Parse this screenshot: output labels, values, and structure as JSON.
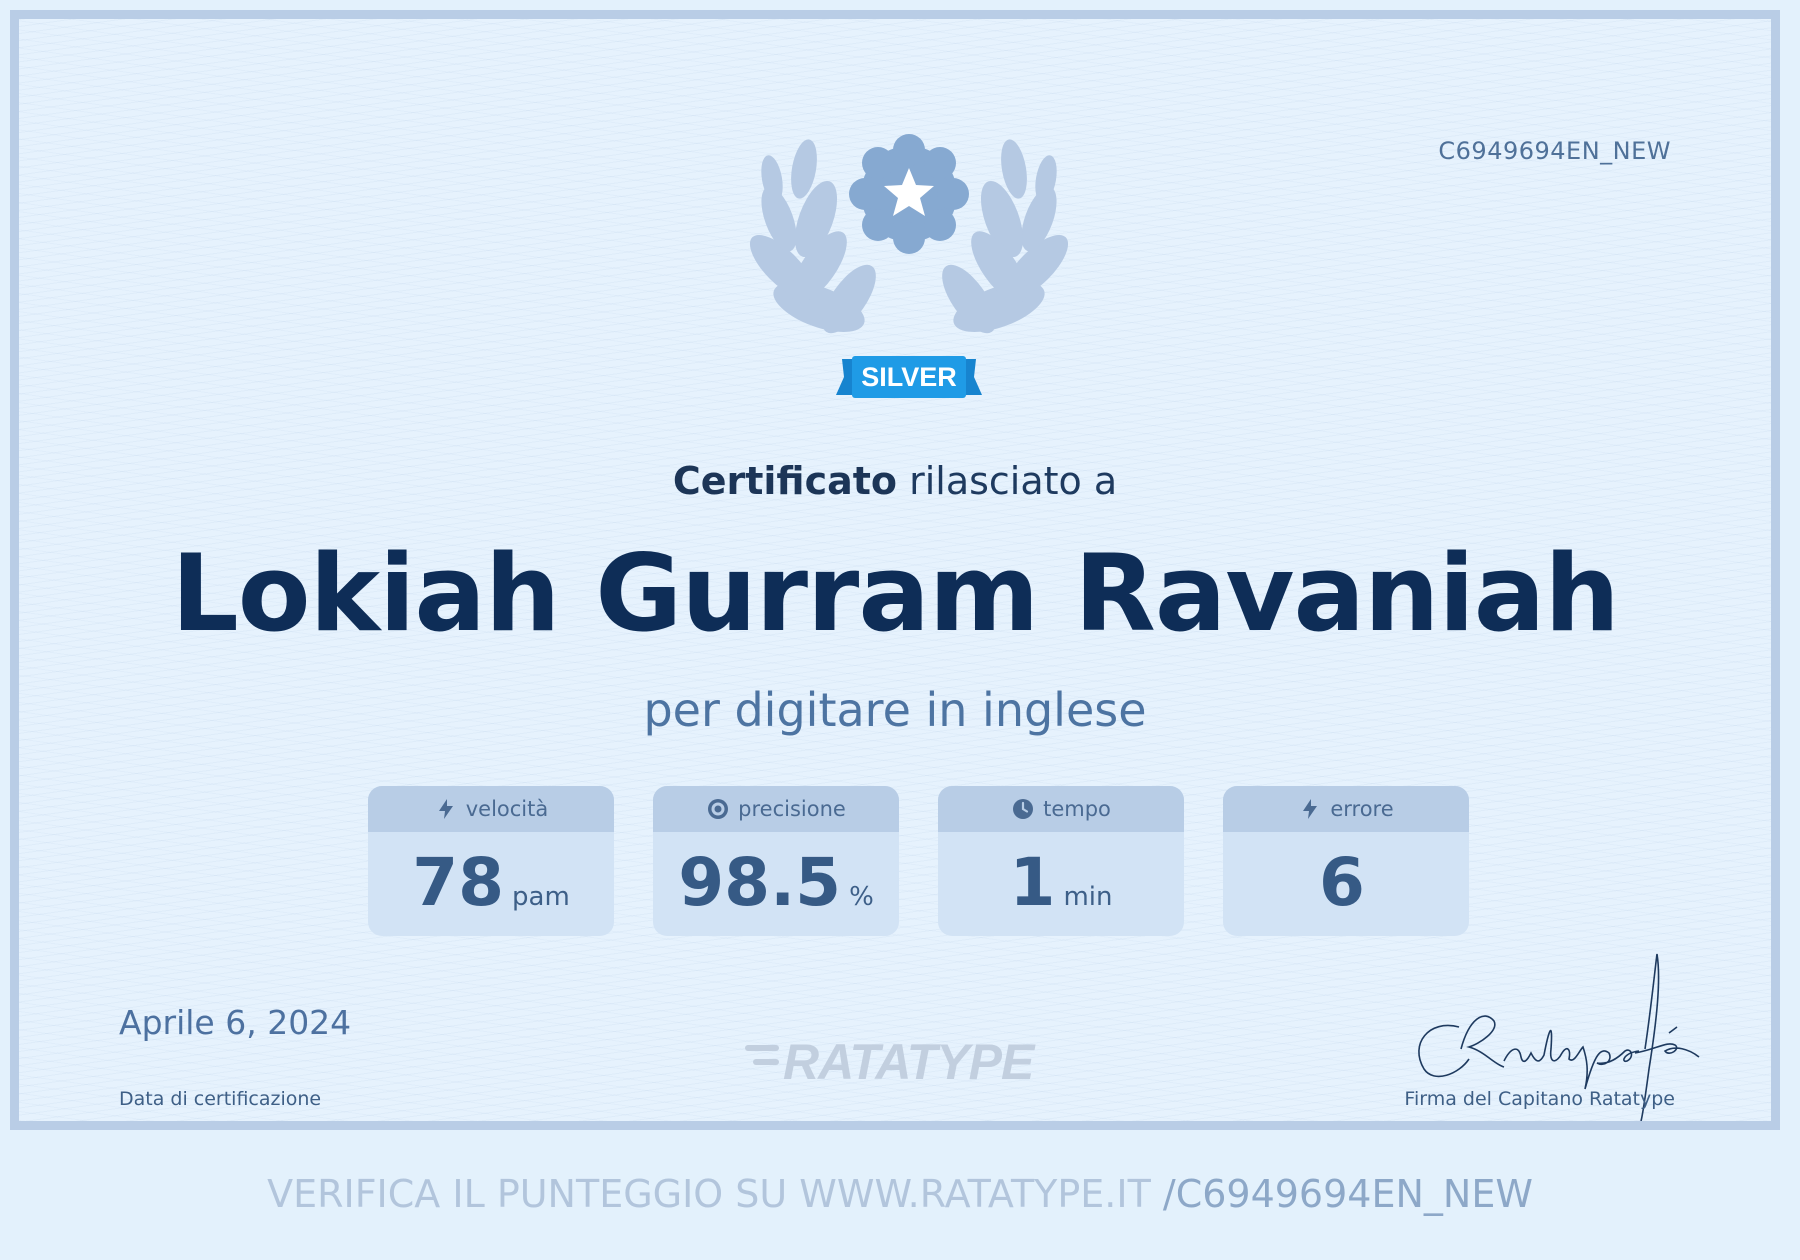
{
  "certificate": {
    "id": "C6949694EN_NEW",
    "badge_level": "SILVER",
    "issued_bold": "Certificato",
    "issued_rest": " rilasciato a",
    "recipient_name": "Lokiah Gurram Ravaniah",
    "subject": "per digitare in inglese",
    "date": "Aprile 6, 2024",
    "date_caption": "Data di certificazione",
    "signature_caption": "Firma del Capitano Ratatype",
    "logo_text": "RATATYPE",
    "verify_text": "VERIFICA IL PUNTEGGIO SU WWW.RATATYPE.IT ",
    "verify_code": "/C6949694EN_NEW"
  },
  "stats": [
    {
      "icon": "lightning-icon",
      "label": "velocità",
      "value": "78",
      "unit": "pam"
    },
    {
      "icon": "target-icon",
      "label": "precisione",
      "value": "98.5",
      "unit": "%"
    },
    {
      "icon": "clock-icon",
      "label": "tempo",
      "value": "1",
      "unit": "min"
    },
    {
      "icon": "lightning-icon",
      "label": "errore",
      "value": "6",
      "unit": ""
    }
  ],
  "colors": {
    "border": "#b9cde6",
    "name": "#0e2d57",
    "accent_ribbon": "#1f9be6",
    "badge_blue": "#86a9d1"
  }
}
